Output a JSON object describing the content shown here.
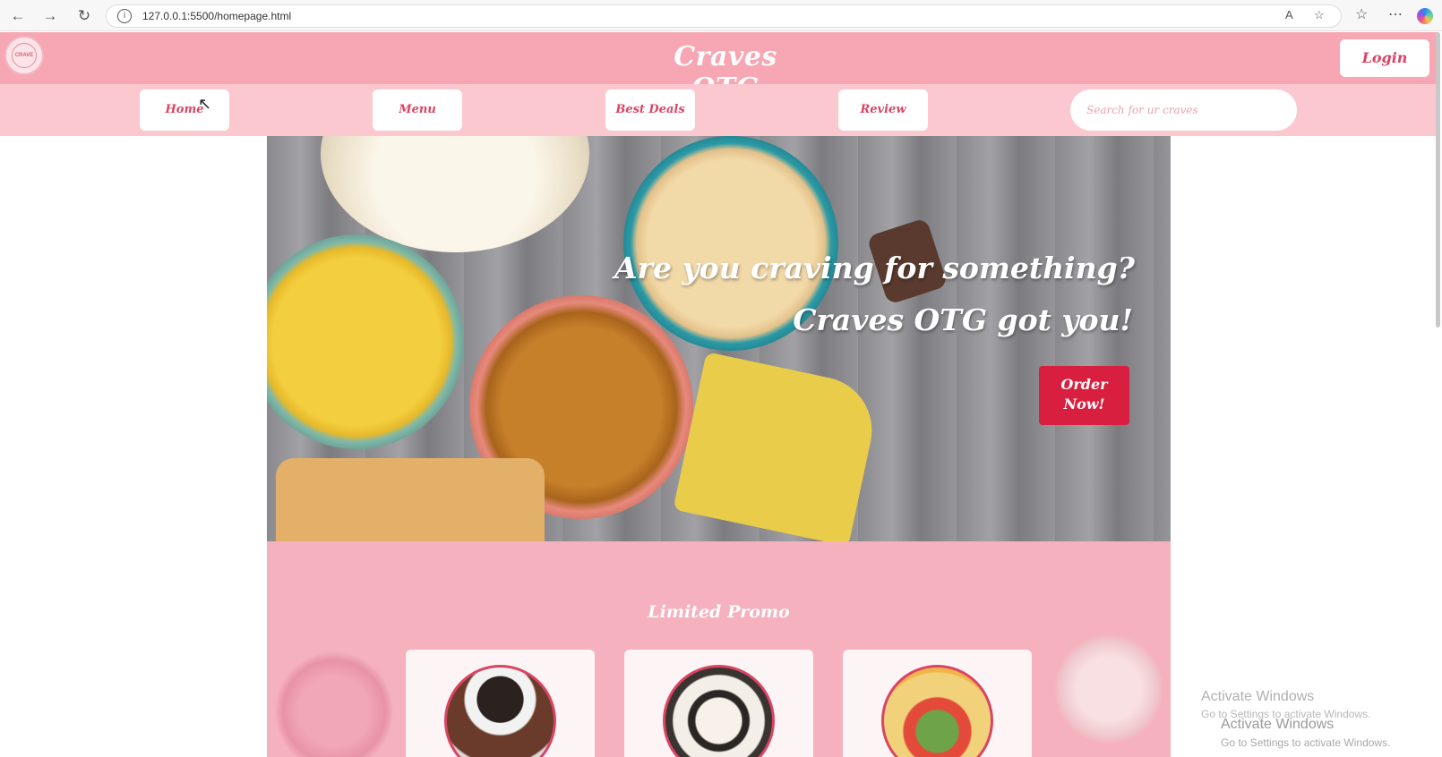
{
  "browser": {
    "url": "127.0.0.1:5500/homepage.html"
  },
  "header": {
    "brand": "Craves OTG",
    "login_label": "Login",
    "logo_text": "CRAVE"
  },
  "nav": {
    "items": [
      {
        "label": "Home"
      },
      {
        "label": "Menu"
      },
      {
        "label": "Best Deals"
      },
      {
        "label": "Review"
      }
    ],
    "search_placeholder": "Search for ur craves"
  },
  "hero": {
    "line1": "Are you craving for something?",
    "line2": "Craves OTG got you!",
    "order_line1": "Order",
    "order_line2": "Now!"
  },
  "promo": {
    "title": "Limited Promo",
    "cards": [
      {
        "image": "donut-coffee-image"
      },
      {
        "image": "cupcakes-image"
      },
      {
        "image": "combo-meal-image"
      }
    ]
  },
  "watermark": {
    "title": "Activate Windows",
    "subtitle": "Go to Settings to activate Windows."
  },
  "colors": {
    "header_pink": "#f7a6b3",
    "nav_pink": "#fcc8d0",
    "accent_red": "#d81f3f",
    "text_pink": "#d94463"
  }
}
